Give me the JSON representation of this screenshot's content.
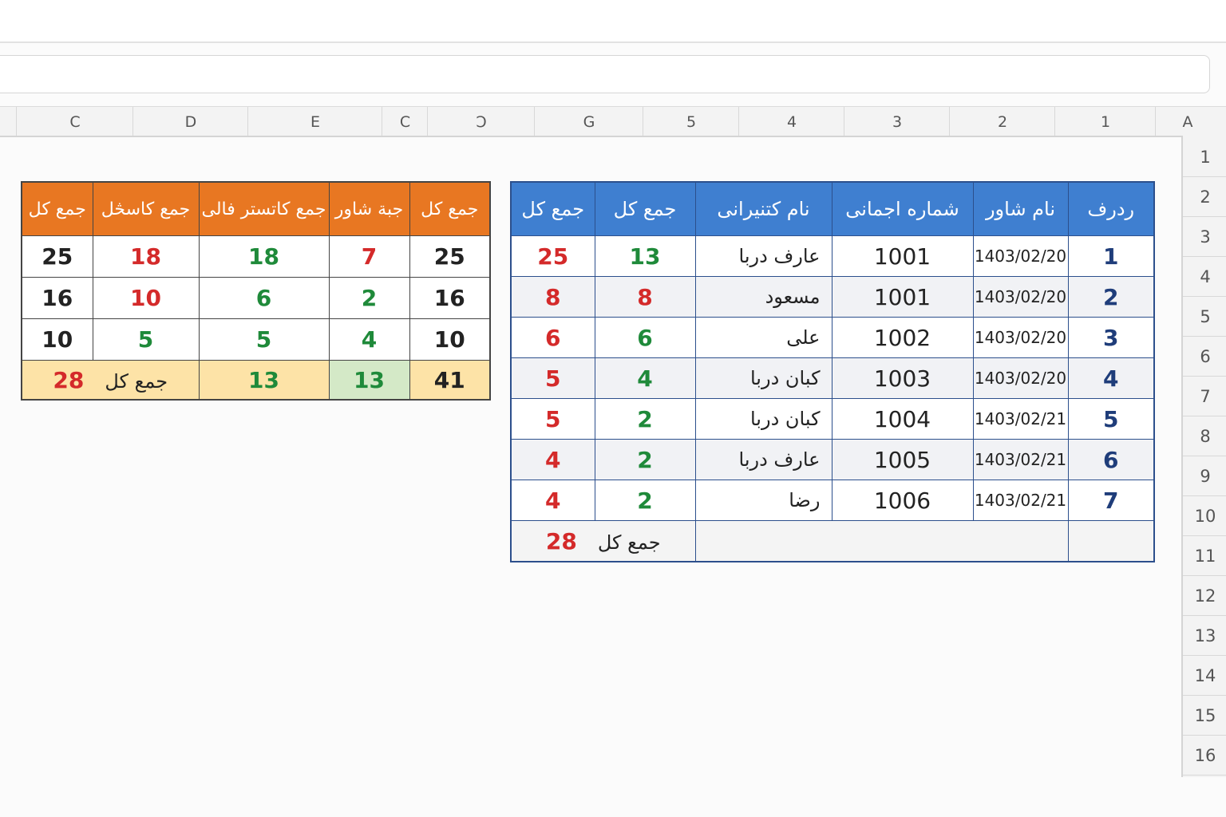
{
  "column_headers": [
    "C",
    "D",
    "E",
    "C",
    "Ͻ",
    "G",
    "5",
    "4",
    "3",
    "2",
    "1",
    "A"
  ],
  "row_headers": [
    "1",
    "2",
    "3",
    "4",
    "5",
    "6",
    "7",
    "8",
    "9",
    "10",
    "11",
    "12",
    "13",
    "14",
    "15",
    "16"
  ],
  "summary_table": {
    "headers": [
      "جمع کل",
      "جمع کاسڅل",
      "جمع کاتستر فالی",
      "جبة شاور",
      "جمع کل"
    ],
    "rows": [
      [
        "25",
        "18",
        "18",
        "7",
        "25"
      ],
      [
        "16",
        "10",
        "6",
        "2",
        "16"
      ],
      [
        "10",
        "5",
        "5",
        "4",
        "10"
      ]
    ],
    "total": {
      "label": "جمع کل",
      "values": [
        "28",
        "13",
        "13",
        "41"
      ]
    }
  },
  "main_table": {
    "headers": [
      "جمع کل",
      "جمع کل",
      "نام کتنیرانی",
      "شماره اجمانی",
      "نام شاور",
      "ردرف"
    ],
    "rows": [
      {
        "a": "25",
        "b": "13",
        "name": "عارف دربا",
        "id": "1001",
        "date": "1403/02/20",
        "row": "1"
      },
      {
        "a": "8",
        "b": "8",
        "name": "مسعود",
        "id": "1001",
        "date": "1403/02/20",
        "row": "2"
      },
      {
        "a": "6",
        "b": "6",
        "name": "علی",
        "id": "1002",
        "date": "1403/02/20",
        "row": "3"
      },
      {
        "a": "5",
        "b": "4",
        "name": "کبان دربا",
        "id": "1003",
        "date": "1403/02/20",
        "row": "4"
      },
      {
        "a": "5",
        "b": "2",
        "name": "کبان دربا",
        "id": "1004",
        "date": "1403/02/21",
        "row": "5"
      },
      {
        "a": "4",
        "b": "2",
        "name": "عارف دربا",
        "id": "1005",
        "date": "1403/02/21",
        "row": "6"
      },
      {
        "a": "4",
        "b": "2",
        "name": "رضا",
        "id": "1006",
        "date": "1403/02/21",
        "row": "7"
      }
    ],
    "total": {
      "label": "جمع کل",
      "value": "28"
    }
  },
  "colors": {
    "orange_header": "#e87722",
    "blue_header": "#3f7fd0",
    "red": "#d42a2a",
    "green": "#1f8a3a",
    "total_fill": "#fde3a7"
  }
}
